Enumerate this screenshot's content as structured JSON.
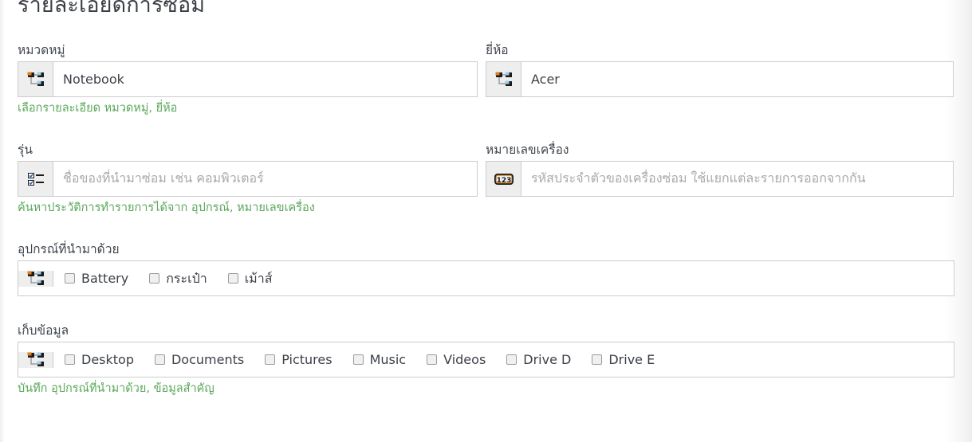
{
  "page": {
    "title": "รายละเอียดการซ่อม"
  },
  "fields": {
    "category": {
      "label": "หมวดหมู่",
      "value": "Notebook",
      "icon": "sitemap-icon"
    },
    "brand": {
      "label": "ยี่ห้อ",
      "value": "Acer",
      "icon": "sitemap-icon"
    },
    "model": {
      "label": "รุ่น",
      "value": "",
      "placeholder": "ชื่อของที่นำมาซ่อม เช่น คอมพิวเตอร์",
      "icon": "tasks-icon"
    },
    "serial": {
      "label": "หมายเลขเครื่อง",
      "value": "",
      "placeholder": "รหัสประจำตัวของเครื่องซ่อม ใช้แยกแต่ละรายการออกจากกัน",
      "icon": "numeric-123-icon"
    },
    "accessories": {
      "label": "อุปกรณ์ที่นำมาด้วย",
      "icon": "sitemap-icon",
      "options": [
        {
          "label": "Battery",
          "checked": false
        },
        {
          "label": "กระเป๋า",
          "checked": false
        },
        {
          "label": "เม้าส์",
          "checked": false
        }
      ]
    },
    "storage": {
      "label": "เก็บข้อมูล",
      "icon": "sitemap-icon",
      "options": [
        {
          "label": "Desktop",
          "checked": false
        },
        {
          "label": "Documents",
          "checked": false
        },
        {
          "label": "Pictures",
          "checked": false
        },
        {
          "label": "Music",
          "checked": false
        },
        {
          "label": "Videos",
          "checked": false
        },
        {
          "label": "Drive D",
          "checked": false
        },
        {
          "label": "Drive E",
          "checked": false
        }
      ]
    }
  },
  "help": {
    "row1": "เลือกรายละเอียด หมวดหมู่, ยี่ห้อ",
    "row2": "ค้นหาประวัติการทำรายการได้จาก อุปกรณ์, หมายเลขเครื่อง",
    "row3": "บันทึก อุปกรณ์ที่นำมาด้วย, ข้อมูลสำคัญ"
  },
  "colors": {
    "help_green": "#5aa75a",
    "label_gray": "#40454d",
    "border_gray": "#cccccc",
    "addon_bg": "#eeeeee",
    "placeholder": "#a9a9a9"
  }
}
